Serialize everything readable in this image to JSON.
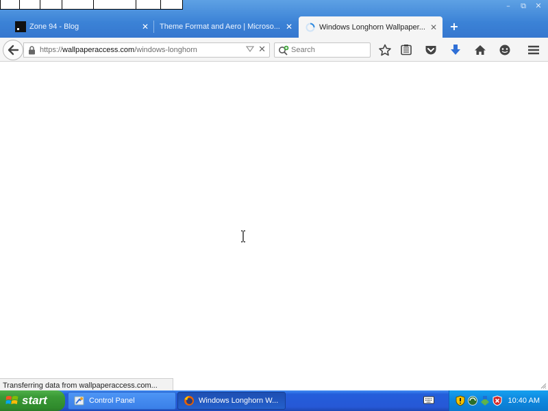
{
  "browser": {
    "tabs": [
      {
        "title": "Zone 94 - Blog",
        "active": false,
        "favicon": "zone94-favicon"
      },
      {
        "title": "Theme Format and Aero | Microso...",
        "active": false,
        "favicon": "none"
      },
      {
        "title": "Windows Longhorn Wallpaper...",
        "active": true,
        "favicon": "loading-spinner-icon"
      }
    ],
    "new_tab_icon": "plus-icon",
    "url": {
      "protocol": "https://",
      "host": "wallpaperaccess.com",
      "path": "/windows-longhorn"
    },
    "search_placeholder": "Search",
    "toolbar_icons": [
      "star-icon",
      "reader-list-icon",
      "pocket-icon",
      "download-icon",
      "home-icon",
      "chat-icon",
      "menu-icon"
    ],
    "status_text": "Transferring data from wallpaperaccess.com..."
  },
  "taskbar": {
    "start_label": "start",
    "tasks": [
      {
        "label": "Control Panel",
        "active": false,
        "icon": "control-panel-icon"
      },
      {
        "label": "Windows Longhorn W...",
        "active": true,
        "icon": "firefox-icon"
      }
    ],
    "tray_icons": [
      "keyboard-icon",
      "security-shield-icon",
      "network-icon",
      "update-icon",
      "antivirus-shield-icon"
    ],
    "clock": "10:40 AM"
  },
  "colors": {
    "titlebar": "#3b82d6",
    "taskbar": "#245edb",
    "start_button": "#3b9a36",
    "tray": "#0f8ae0",
    "download_arrow": "#2f6fd6"
  }
}
